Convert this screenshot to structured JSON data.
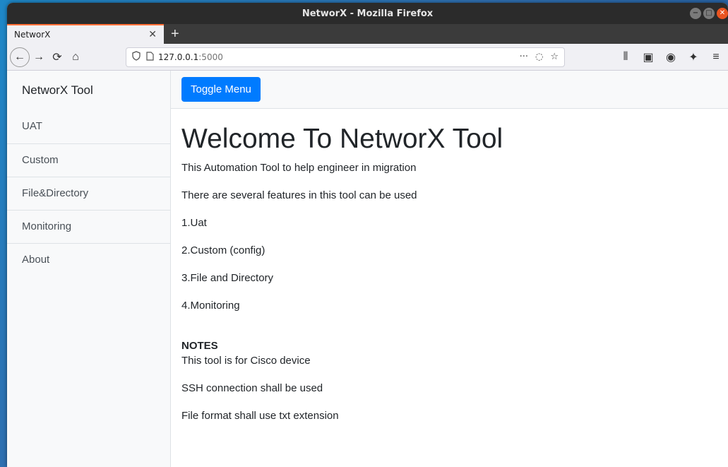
{
  "window": {
    "title": "NetworX - Mozilla Firefox",
    "controls": [
      "−",
      "□",
      "✕"
    ]
  },
  "tab": {
    "label": "NetworX",
    "close": "✕",
    "new_tab": "+"
  },
  "nav": {
    "back": "←",
    "forward": "→",
    "reload": "⟳",
    "home": "⌂",
    "url_host": "127.0.0.1",
    "url_port": ":5000",
    "menu_dots": "···",
    "pocket": "◌",
    "star": "☆",
    "library": "⫴",
    "sidebar_toggle": "▣",
    "account": "◉",
    "extensions": "✦",
    "hamburger": "≡"
  },
  "sidebar": {
    "heading": "NetworX Tool",
    "items": [
      {
        "label": "UAT"
      },
      {
        "label": "Custom"
      },
      {
        "label": "File&Directory"
      },
      {
        "label": "Monitoring"
      },
      {
        "label": "About"
      }
    ]
  },
  "topnav": {
    "toggle_label": "Toggle Menu"
  },
  "page": {
    "title": "Welcome To NetworX Tool",
    "intro": "This Automation Tool to help engineer in migration",
    "features_intro": "There are several features in this tool can be used",
    "features": [
      "1.Uat",
      "2.Custom (config)",
      "3.File and Directory",
      "4.Monitoring"
    ],
    "notes_title": "NOTES",
    "notes": [
      "This tool is for Cisco device",
      "SSH connection shall be used",
      "File format shall use txt extension"
    ]
  },
  "colors": {
    "accent": "#007bff",
    "tab_highlight": "#ff7139",
    "desktop": "#1e88c8"
  }
}
